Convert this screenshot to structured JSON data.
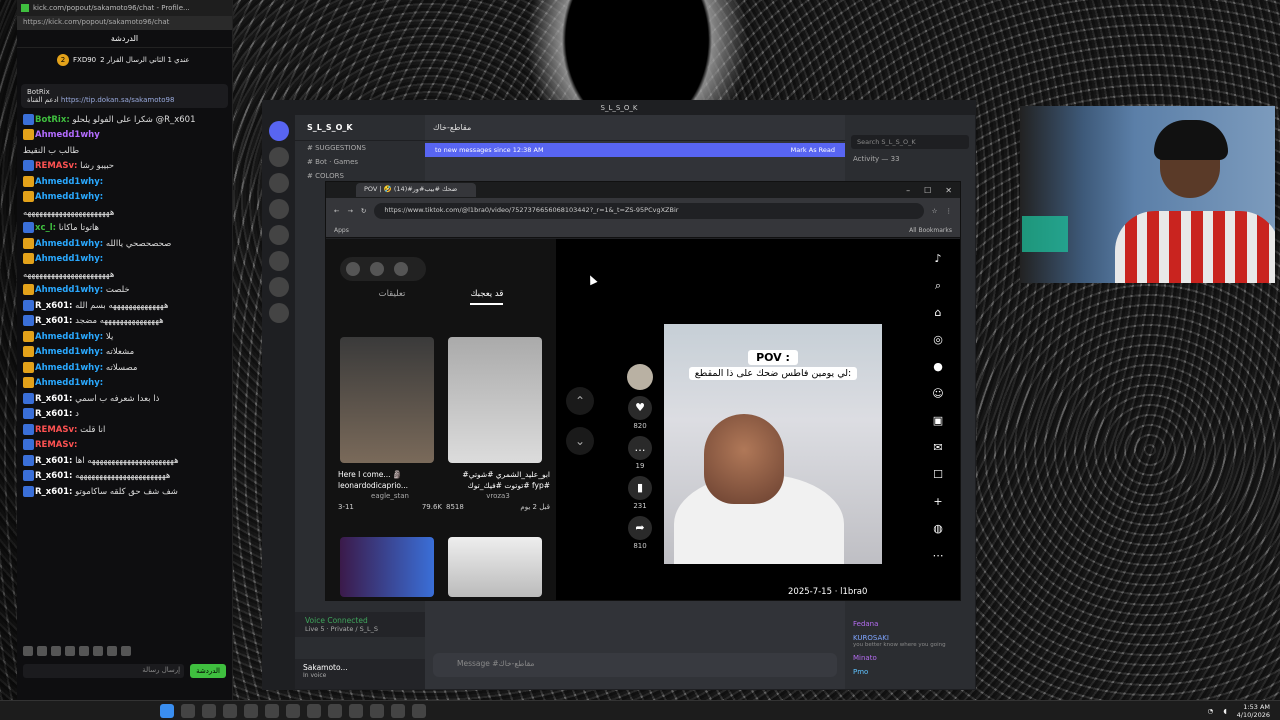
{
  "kick": {
    "title": "kick.com/popout/sakamoto96/chat - Profile...",
    "url": "https://kick.com/popout/sakamoto96/chat",
    "chat_header": "الدردشة",
    "top_user": "FXD90",
    "top_user_rank": "2",
    "top_user_msg": "عندي 1 الثاني الرسال القرار 2",
    "pinned_from": "BotRix",
    "pinned_text": "ادعم القناة",
    "pinned_link": "https://tip.dokan.sa/sakamoto98",
    "messages": [
      {
        "user": "BotRix:",
        "color": "#3fbf3f",
        "text": "شكرا على الفولو يلحلو @R_x601"
      },
      {
        "user": "Ahmedd1why",
        "color": "#b36cff",
        "text": ""
      },
      {
        "user": "",
        "color": "#ddd",
        "text": "طالب ب النقيط"
      },
      {
        "user": "REMASv:",
        "color": "#ff5252",
        "text": "حبيبو رشا"
      },
      {
        "user": "Ahmedd1why:",
        "color": "#2aa9ff",
        "text": ""
      },
      {
        "user": "Ahmedd1why:",
        "color": "#2aa9ff",
        "text": ""
      },
      {
        "user": "",
        "color": "#ddd",
        "text": "ههههههههههههههههههههههه"
      },
      {
        "user": "xc_l:",
        "color": "#3fbf3f",
        "text": "هاتوتا ماكانا"
      },
      {
        "user": "Ahmedd1why:",
        "color": "#2aa9ff",
        "text": "صحصحصحي ياالله"
      },
      {
        "user": "Ahmedd1why:",
        "color": "#2aa9ff",
        "text": ""
      },
      {
        "user": "",
        "color": "#ddd",
        "text": "ههههههههههههههههههههههه"
      },
      {
        "user": "Ahmedd1why:",
        "color": "#2aa9ff",
        "text": "خلصت"
      },
      {
        "user": "R_x601:",
        "color": "#ffffff",
        "text": "ههههههههههههههه بسم الله"
      },
      {
        "user": "R_x601:",
        "color": "#ffffff",
        "text": "هههههههههههههههه مضجد"
      },
      {
        "user": "Ahmedd1why:",
        "color": "#2aa9ff",
        "text": "يلا"
      },
      {
        "user": "Ahmedd1why:",
        "color": "#2aa9ff",
        "text": "مشعلاته"
      },
      {
        "user": "Ahmedd1why:",
        "color": "#2aa9ff",
        "text": "مصسلاته"
      },
      {
        "user": "Ahmedd1why:",
        "color": "#2aa9ff",
        "text": ""
      },
      {
        "user": "R_x601:",
        "color": "#ffffff",
        "text": "ذا بعدا شعرفه ب اسمي"
      },
      {
        "user": "R_x601:",
        "color": "#ffffff",
        "text": "د"
      },
      {
        "user": "REMASv:",
        "color": "#ff5252",
        "text": "انا قلت"
      },
      {
        "user": "REMASv:",
        "color": "#ff5252",
        "text": ""
      },
      {
        "user": "R_x601:",
        "color": "#ffffff",
        "text": "ههههههههههههههههههههههه اها"
      },
      {
        "user": "R_x601:",
        "color": "#ffffff",
        "text": "هههههههههههههههههههههههه"
      },
      {
        "user": "R_x601:",
        "color": "#ffffff",
        "text": "شف شف حق كلقه ساكاموتو"
      }
    ],
    "send_placeholder": "إرسال رسالة",
    "send_button": "الدردشة"
  },
  "discord": {
    "title": "S_L_S_O_K",
    "server_name": "S_L_S_O_K",
    "categories": [
      "# SUGGESTIONS",
      "# Bot · Games",
      "# COLORS"
    ],
    "channel_title": "مقاطع-خاك",
    "new_messages": "to new messages since 12:38 AM",
    "mark_as_read": "Mark As Read",
    "search_placeholder": "Search S_L_S_O_K",
    "members_header": "Activity — 33",
    "members": [
      {
        "name": "Fedana",
        "status": "",
        "color": "#b46cf0"
      },
      {
        "name": "KUROSAKI",
        "status": "you better know where you going",
        "color": "#7fa5ff"
      },
      {
        "name": "Minato",
        "status": "",
        "color": "#b46cf0"
      },
      {
        "name": "Pmo",
        "status": "",
        "color": "#5fc3ff"
      }
    ],
    "voice_connected": "Voice Connected",
    "voice_server": "Live 5 · Private / S_L_S",
    "composer_placeholder": "Message #مقاطع-خاك",
    "user_name": "Sakamoto...",
    "user_status": "In voice"
  },
  "chrome": {
    "tab_title": "POV | 🤣 ضحك #بيب#ور#(14)",
    "url": "https://www.tiktok.com/@l1bra0/video/7527376656068103442?_r=1&_t=ZS-95PCvgXZBir",
    "bookmarks_apps": "Apps",
    "bookmarks_all": "All Bookmarks"
  },
  "tiktok": {
    "tab_liked": "قد يعجبك",
    "tab_comments": "تعليقات",
    "videos": [
      {
        "title": "Here I come... 🗿 leonardodicaprio...",
        "author": "eagle_stan",
        "date": "3-11",
        "likes": "79.6K"
      },
      {
        "title": "#ابو_عليد_الشمري #شوتي #توتوت #فيك_توك fyp#",
        "author": "vroza3",
        "date": "قبل 2 يوم",
        "likes": "8518"
      }
    ],
    "pov_line1": "POV :",
    "pov_line2": "لي يومين فاطس ضحك على ذا المقطع:",
    "likes": "820",
    "comments": "19",
    "saves": "231",
    "shares": "810",
    "author": "l1bra0",
    "date": "2025-7-15"
  },
  "taskbar": {
    "time": "1:53 AM",
    "date": "4/10/2026"
  }
}
